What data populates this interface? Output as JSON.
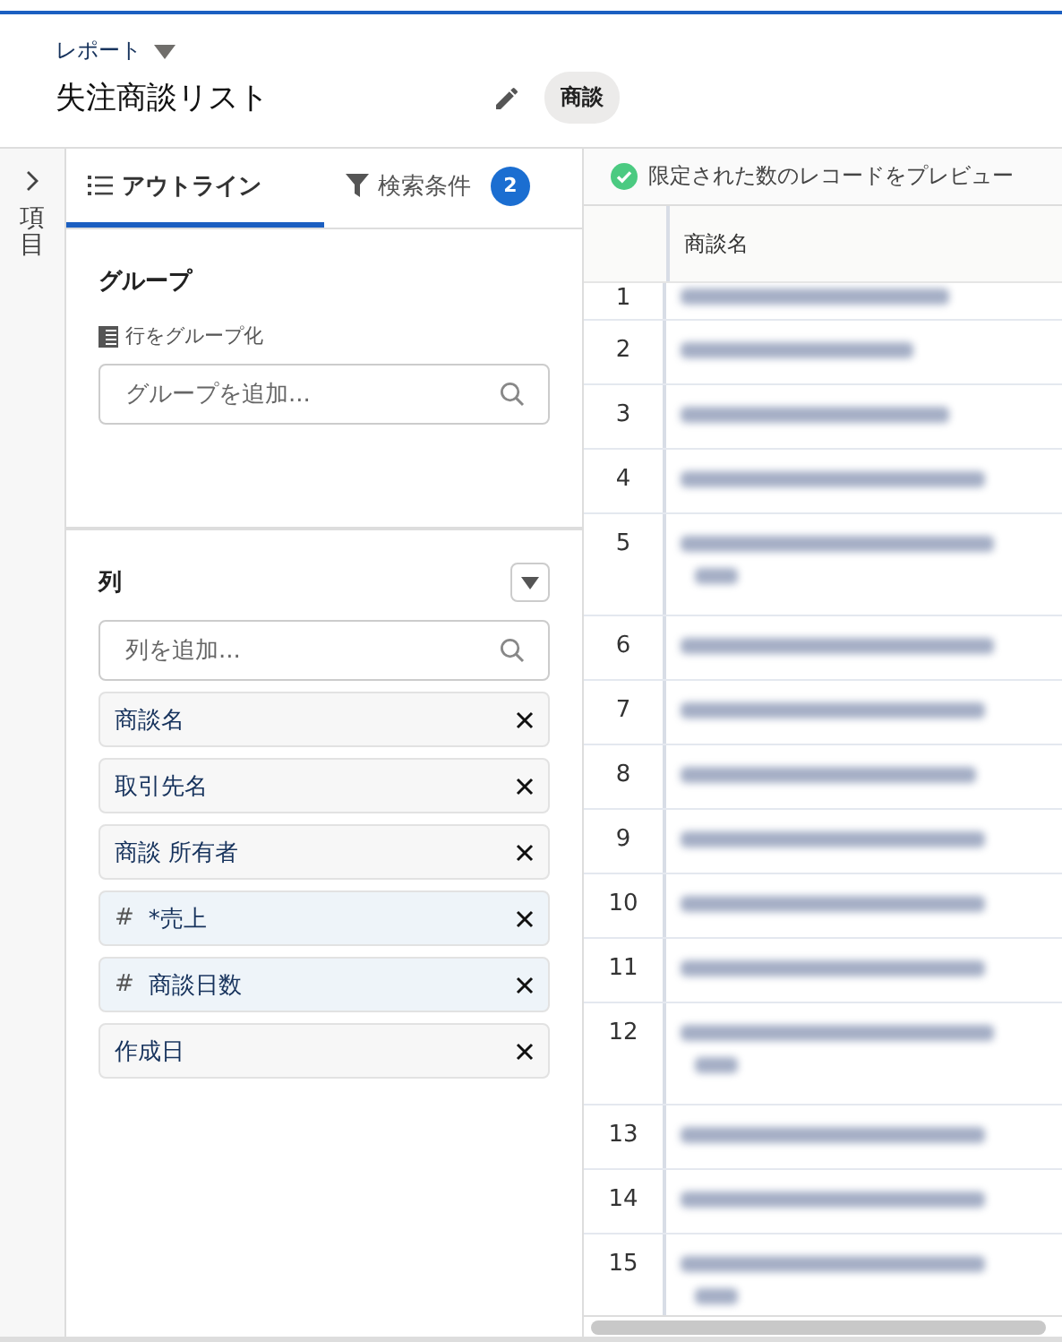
{
  "header": {
    "breadcrumb": "レポート",
    "title": "失注商談リスト",
    "object_badge": "商談"
  },
  "rail": {
    "label": "項目"
  },
  "tabs": [
    {
      "label": "アウトライン",
      "selected": true
    },
    {
      "label": "検索条件",
      "selected": false,
      "count": "2"
    }
  ],
  "groups": {
    "heading": "グループ",
    "sub_label": "行をグループ化",
    "search": {
      "placeholder": "グループを追加..."
    }
  },
  "columns": {
    "heading": "列",
    "search": {
      "placeholder": "列を追加..."
    },
    "items": [
      {
        "label": "商談名",
        "kind": "text"
      },
      {
        "label": "取引先名",
        "kind": "text"
      },
      {
        "label": "商談 所有者",
        "kind": "text"
      },
      {
        "label": "*売上",
        "kind": "number",
        "prefix": "#"
      },
      {
        "label": "商談日数",
        "kind": "number",
        "prefix": "#"
      },
      {
        "label": "作成日",
        "kind": "text"
      }
    ]
  },
  "preview": {
    "notice": "限定された数のレコードをプレビュー",
    "table": {
      "columns": [
        "商談名"
      ],
      "rows": [
        {
          "number": "1",
          "wrapped": false
        },
        {
          "number": "2",
          "wrapped": false
        },
        {
          "number": "3",
          "wrapped": false
        },
        {
          "number": "4",
          "wrapped": false
        },
        {
          "number": "5",
          "wrapped": true
        },
        {
          "number": "6",
          "wrapped": false
        },
        {
          "number": "7",
          "wrapped": false
        },
        {
          "number": "8",
          "wrapped": false
        },
        {
          "number": "9",
          "wrapped": false
        },
        {
          "number": "10",
          "wrapped": false
        },
        {
          "number": "11",
          "wrapped": false
        },
        {
          "number": "12",
          "wrapped": true
        },
        {
          "number": "13",
          "wrapped": false
        },
        {
          "number": "14",
          "wrapped": false
        },
        {
          "number": "15",
          "wrapped": true
        }
      ]
    }
  }
}
